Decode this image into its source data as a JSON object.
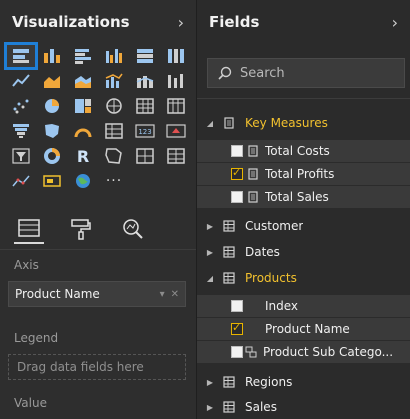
{
  "visualizations": {
    "title": "Visualizations",
    "tabs": [
      "fields-well",
      "format-roller",
      "analytics-magnifier"
    ],
    "wells": {
      "axis_label": "Axis",
      "axis_value": "Product Name",
      "legend_label": "Legend",
      "legend_placeholder": "Drag data fields here",
      "value_label": "Value"
    },
    "icons": [
      "stacked-bar-chart-icon",
      "stacked-column-chart-icon",
      "clustered-bar-chart-icon",
      "clustered-column-chart-icon",
      "100-stacked-bar-chart-icon",
      "100-stacked-column-chart-icon",
      "line-chart-icon",
      "area-chart-icon",
      "stacked-area-chart-icon",
      "line-and-column-chart-icon",
      "line-and-stacked-column-chart-icon",
      "ribbon-chart-icon",
      "waterfall-chart-icon",
      "scatter-chart-icon",
      "pie-chart-icon",
      "treemap-icon",
      "map-icon",
      "table-icon",
      "funnel-icon",
      "filled-map-icon",
      "gauge-icon",
      "matrix-icon",
      "card-icon",
      "kpi-icon",
      "slicer-icon",
      "donut-chart-icon",
      "r-visual-icon",
      "shape-map-icon",
      "globe-icon",
      "table-visual-icon",
      "custom-visual-icon",
      "multi-row-card-icon",
      "arcgis-map-icon",
      "more-icon"
    ],
    "more_label": "···",
    "r_label": "R"
  },
  "fields": {
    "title": "Fields",
    "search_placeholder": "Search",
    "tables": [
      {
        "name": "Key Measures",
        "expanded": true,
        "highlight": true,
        "type": "measures",
        "items": [
          {
            "name": "Total Costs",
            "checked": false
          },
          {
            "name": "Total Profits",
            "checked": true
          },
          {
            "name": "Total Sales",
            "checked": false
          }
        ]
      },
      {
        "name": "Customer",
        "expanded": false
      },
      {
        "name": "Dates",
        "expanded": false
      },
      {
        "name": "Products",
        "expanded": true,
        "highlight": true,
        "items": [
          {
            "name": "Index",
            "checked": false
          },
          {
            "name": "Product Name",
            "checked": true
          },
          {
            "name": "Product Sub Catego...",
            "checked": false
          }
        ]
      },
      {
        "name": "Regions",
        "expanded": false
      },
      {
        "name": "Sales",
        "expanded": false
      }
    ]
  },
  "colors": {
    "accent_blue": "#1f7fd6",
    "highlight_yellow": "#f2c12e",
    "icon_blue": "#9cc6ef",
    "icon_orange": "#f0a73a"
  }
}
